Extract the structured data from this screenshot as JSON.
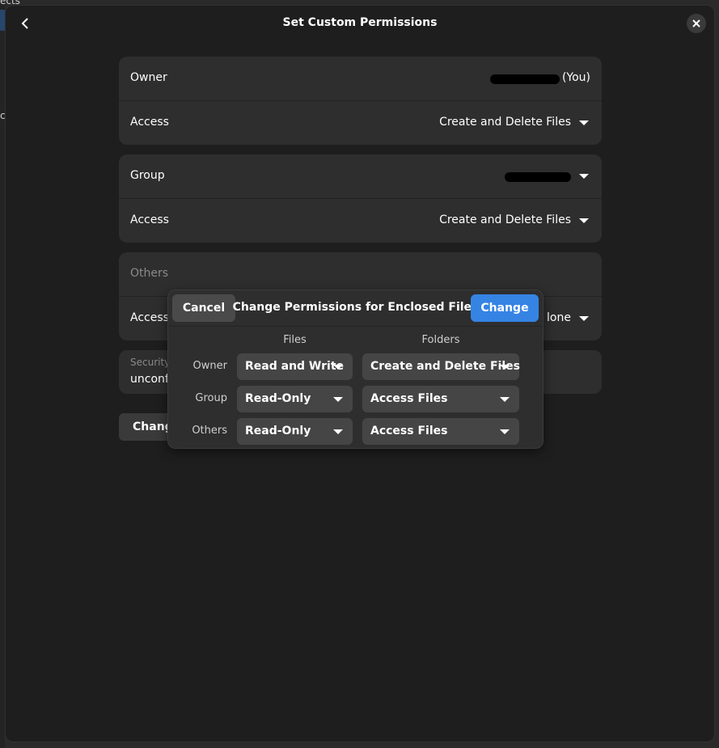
{
  "background": {
    "top_text": "ects",
    "mid_text": "c"
  },
  "window": {
    "title": "Set Custom Permissions"
  },
  "owner_section": {
    "owner_label": "Owner",
    "owner_suffix": "(You)",
    "access_label": "Access",
    "access_value": "Create and Delete Files"
  },
  "group_section": {
    "group_label": "Group",
    "access_label": "Access",
    "access_value": "Create and Delete Files"
  },
  "others_section": {
    "others_label": "Others",
    "access_label": "Access",
    "access_value_partial": "lone"
  },
  "security": {
    "title": "Security C",
    "value": "unconfin"
  },
  "change_button_bg": "Change",
  "dialog": {
    "title": "Change Permissions for Enclosed Files",
    "cancel_label": "Cancel",
    "change_label": "Change",
    "files_header": "Files",
    "folders_header": "Folders",
    "rows": [
      {
        "label": "Owner",
        "files": "Read and Write",
        "folders": "Create and Delete Files"
      },
      {
        "label": "Group",
        "files": "Read-Only",
        "folders": "Access Files"
      },
      {
        "label": "Others",
        "files": "Read-Only",
        "folders": "Access Files"
      }
    ]
  },
  "colors": {
    "accent": "#3584e4",
    "window_bg": "#1e1e1e",
    "row_bg": "#2e2e2e"
  }
}
